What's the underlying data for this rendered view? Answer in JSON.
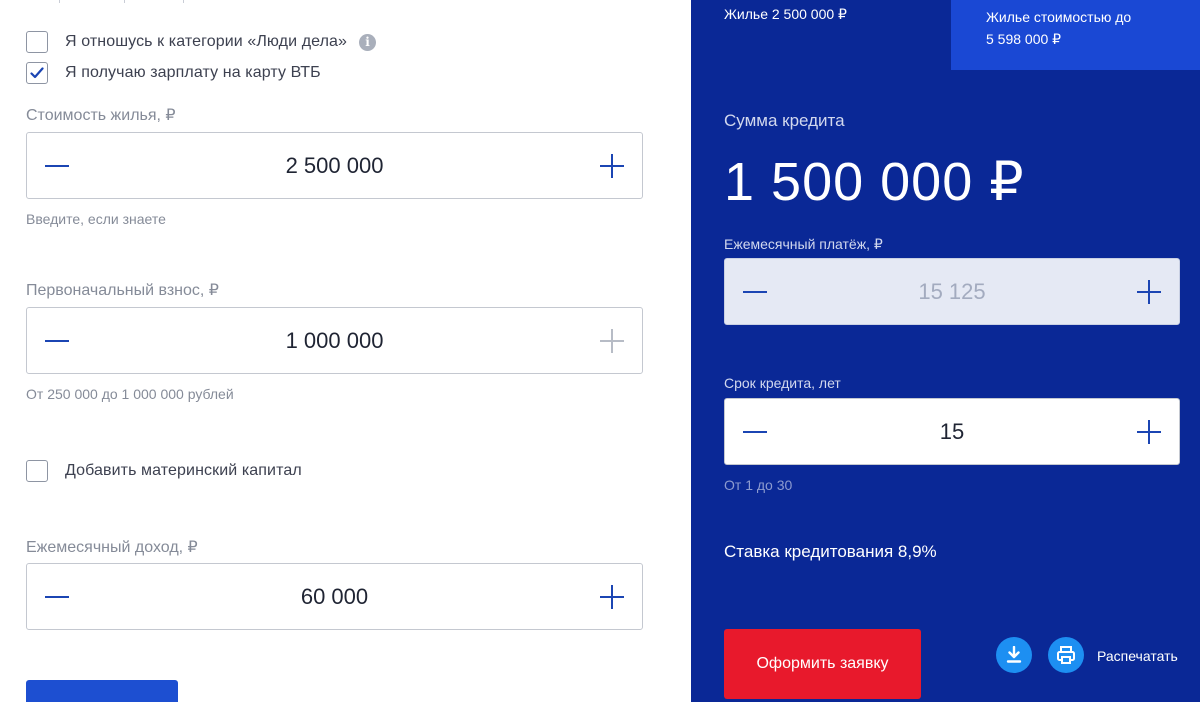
{
  "left": {
    "checkbox_people": {
      "label": "Я отношусь к категории «Люди дела»",
      "checked": false,
      "info_icon": "i"
    },
    "checkbox_salary": {
      "label": "Я получаю зарплату на карту ВТБ",
      "checked": true
    },
    "price": {
      "label": "Стоимость жилья, ₽",
      "value": "2 500 000",
      "hint": "Введите, если знаете"
    },
    "down_payment": {
      "label": "Первоначальный взнос, ₽",
      "value": "1 000 000",
      "hint": "От 250 000 до 1 000 000 рублей"
    },
    "checkbox_maternity": {
      "label": "Добавить материнский капитал",
      "checked": false
    },
    "income": {
      "label": "Ежемесячный доход, ₽",
      "value": "60 000"
    }
  },
  "right": {
    "top_left_text": "Жилье 2 500 000 ₽",
    "top_box_line1": "Жилье стоимостью до",
    "top_box_line2": "5 598 000 ₽",
    "loan_sum_label": "Сумма кредита",
    "loan_sum_value": "1 500 000 ₽",
    "monthly_payment": {
      "label": "Ежемесячный платёж, ₽",
      "value": "15 125"
    },
    "term": {
      "label": "Срок кредита, лет",
      "value": "15",
      "hint": "От 1 до 30"
    },
    "rate_text": "Ставка кредитования 8,9%",
    "apply_button": "Оформить заявку",
    "print_label": "Распечатать"
  },
  "colors": {
    "panel_blue": "#0a2896",
    "accent_blue": "#1a48d4",
    "apply_red": "#e8192c",
    "icon_blue": "#1d8ff2"
  },
  "icons": [
    "info-icon",
    "checkmark-icon",
    "minus-icon",
    "plus-icon",
    "download-icon",
    "printer-icon"
  ]
}
